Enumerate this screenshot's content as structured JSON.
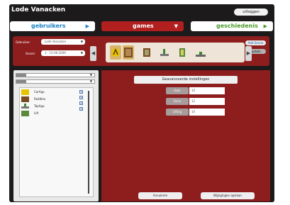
{
  "app": {
    "title": "Lode Vanacken",
    "logout_label": "uitloggen"
  },
  "nav": {
    "users": "gebruikers",
    "games": "games",
    "history": "geschiedenis"
  },
  "toolbar": {
    "user_label": "Gebruiker:",
    "user_value": "Lode Vanacken",
    "session_label": "Sessie:",
    "session_value": "1 - 15-06-2009",
    "add_session_label": "Add Sessie",
    "update_label": "update"
  },
  "library": {
    "dropdown1": "",
    "dropdown2": "",
    "games": [
      {
        "name": "CarApp"
      },
      {
        "name": "Roddleo"
      },
      {
        "name": "TapApp"
      },
      {
        "name": "Lift"
      }
    ]
  },
  "settings": {
    "title": "Geavanceerde instellingen",
    "fields": [
      {
        "label": "Gain",
        "value": "10"
      },
      {
        "label": "Force",
        "value": "12"
      },
      {
        "label": "Lifting",
        "value": "10"
      }
    ]
  },
  "actions": {
    "cancel": "Annuleren",
    "save": "Wijzigingen opslaan"
  },
  "colors": {
    "background": "#1c1a1a",
    "accent_red": "#8e1d1d",
    "games_tab": "#b21f1f",
    "users_blue": "#1a82c4",
    "history_green": "#4a9a2a"
  }
}
